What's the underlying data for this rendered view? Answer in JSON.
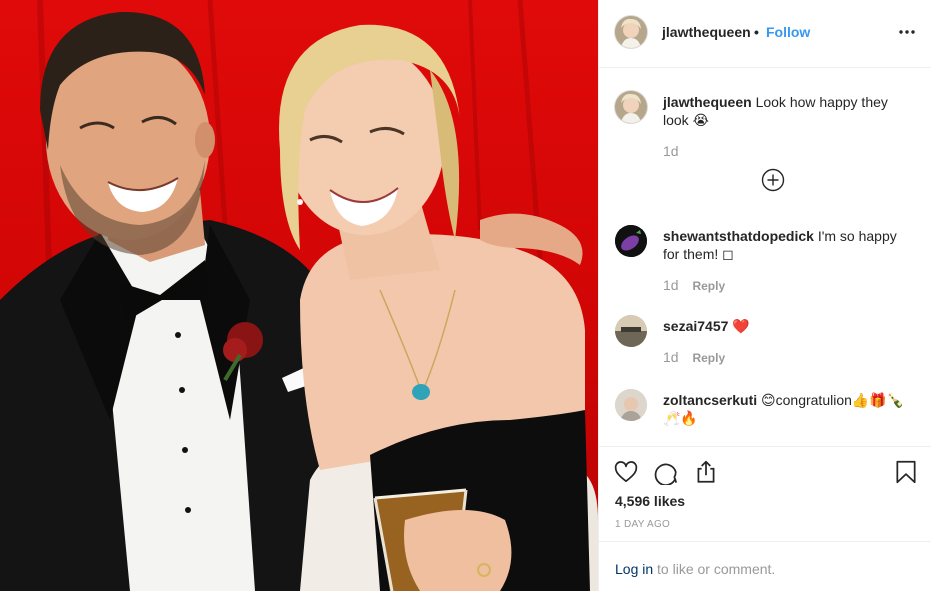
{
  "post": {
    "author": "jlawthequeen",
    "separator": "•",
    "follow_label": "Follow",
    "more_icon": "more-options-icon"
  },
  "caption": {
    "username": "jlawthequeen",
    "text": "Look how happy they look 😭",
    "age": "1d"
  },
  "comments": [
    {
      "username": "shewantsthatdopedick",
      "text": "I'm so happy for them! ◻",
      "age": "1d",
      "reply_label": "Reply"
    },
    {
      "username": "sezai7457",
      "text": "❤️",
      "age": "1d",
      "reply_label": "Reply"
    },
    {
      "username": "zoltancserkuti",
      "text": "😊congratulion👍🎁🍾🥂🔥"
    }
  ],
  "actions": {
    "like_icon": "heart-icon",
    "comment_icon": "comment-icon",
    "share_icon": "share-icon",
    "save_icon": "bookmark-icon"
  },
  "likes": "4,596 likes",
  "date": "1 DAY AGO",
  "login": {
    "link_label": "Log in",
    "rest": " to like or comment."
  },
  "colors": {
    "accent": "#3897f0",
    "link_dark": "#003569",
    "muted": "#999999",
    "border": "#efefef",
    "backdrop": "#d10505"
  }
}
